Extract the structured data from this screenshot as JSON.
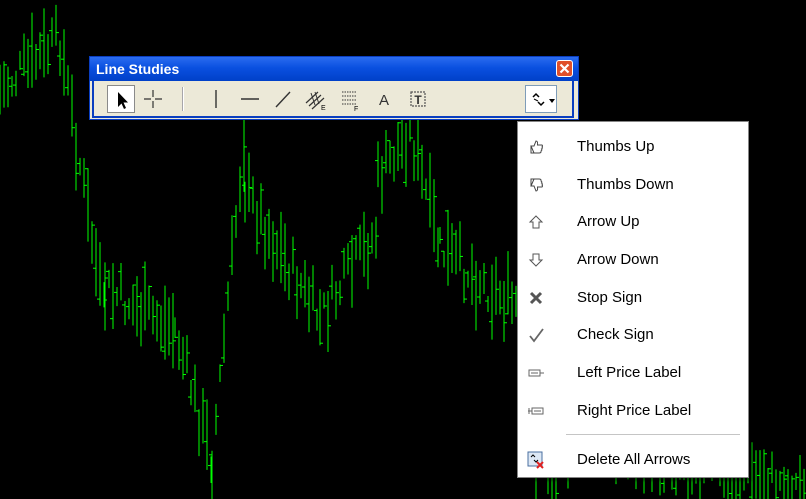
{
  "toolbar": {
    "title": "Line Studies",
    "tools": [
      {
        "name": "cursor-tool",
        "icon": "arrow-cursor-icon"
      },
      {
        "name": "crosshair-tool",
        "icon": "crosshair-icon"
      },
      {
        "name": "vertical-line-tool",
        "icon": "vertical-line-icon"
      },
      {
        "name": "horizontal-line-tool",
        "icon": "horizontal-line-icon"
      },
      {
        "name": "trendline-tool",
        "icon": "trendline-icon"
      },
      {
        "name": "equidistant-channel-tool",
        "icon": "equidistant-channel-icon"
      },
      {
        "name": "fibonacci-retracement-tool",
        "icon": "fibonacci-icon"
      },
      {
        "name": "text-tool",
        "icon": "text-a-icon"
      },
      {
        "name": "text-label-tool",
        "icon": "text-label-icon"
      },
      {
        "name": "arrows-menu-tool",
        "icon": "arrows-dropdown-icon"
      }
    ]
  },
  "menu": {
    "items": [
      {
        "label": "Thumbs Up",
        "icon": "thumbs-up-icon"
      },
      {
        "label": "Thumbs Down",
        "icon": "thumbs-down-icon"
      },
      {
        "label": "Arrow Up",
        "icon": "arrow-up-icon"
      },
      {
        "label": "Arrow Down",
        "icon": "arrow-down-icon"
      },
      {
        "label": "Stop Sign",
        "icon": "stop-sign-icon"
      },
      {
        "label": "Check Sign",
        "icon": "check-sign-icon"
      },
      {
        "label": "Left Price Label",
        "icon": "left-price-label-icon"
      },
      {
        "label": "Right Price Label",
        "icon": "right-price-label-icon"
      },
      {
        "label": "Delete All Arrows",
        "icon": "delete-arrows-icon"
      }
    ]
  },
  "colors": {
    "chart_background": "#000000",
    "bar_color": "#00ff00",
    "titlebar_blue": "#0a50e0",
    "toolbar_face": "#ece9d8"
  }
}
